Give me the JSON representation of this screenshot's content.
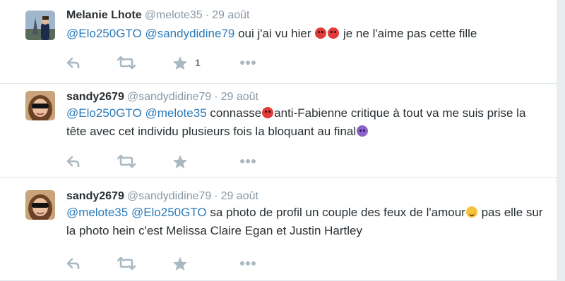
{
  "colors": {
    "mention": "#2b7bb9",
    "muted": "#8899a6",
    "icon": "#aab8c2",
    "text": "#292f33"
  },
  "icons": [
    "reply-icon",
    "retweet-icon",
    "star-icon",
    "more-icon",
    "angry-emoji-icon",
    "devil-emoji-icon",
    "smile-emoji-icon"
  ],
  "tweets": [
    {
      "fullname": "Melanie Lhote",
      "username": "@melote35",
      "sep": "·",
      "time": "29 août",
      "mention1": "@Elo250GTO",
      "mention2": "@sandydidine79",
      "text1": "oui j'ai vu hier",
      "text2": "je ne l'aime pas cette fille",
      "fav_count": "1"
    },
    {
      "fullname": "sandy2679",
      "username": "@sandydidine79",
      "sep": "·",
      "time": "29 août",
      "mention1": "@Elo250GTO",
      "mention2": "@melote35",
      "text1": "connasse",
      "text2": "anti-Fabienne critique à tout va me suis prise la tête avec cet individu plusieurs fois la bloquant au final"
    },
    {
      "fullname": "sandy2679",
      "username": "@sandydidine79",
      "sep": "·",
      "time": "29 août",
      "mention1": "@melote35",
      "mention2": "@Elo250GTO",
      "text1": "sa photo de profil un couple des feux de l'amour",
      "text2": "pas elle sur la photo hein c'est Melissa Claire Egan et Justin Hartley"
    }
  ]
}
